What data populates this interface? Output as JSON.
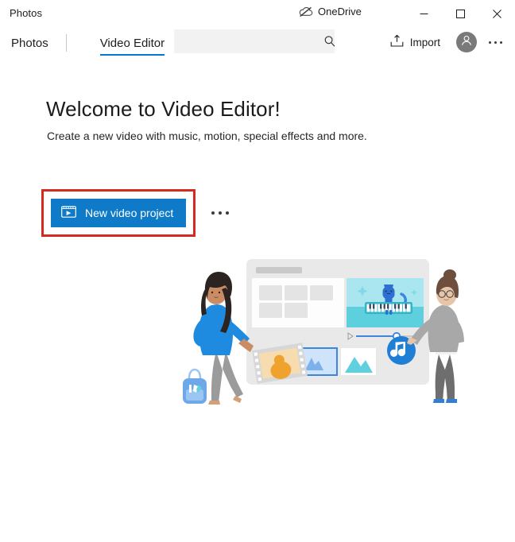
{
  "window": {
    "app_title": "Photos",
    "onedrive_label": "OneDrive",
    "onedrive_icon": "cloud-slash-icon",
    "minimize_label": "Minimize",
    "maximize_label": "Maximize",
    "close_label": "Close"
  },
  "commandbar": {
    "tabs": [
      {
        "label": "Photos",
        "active": false,
        "name": "tab-photos"
      },
      {
        "label": "Video Editor",
        "active": true,
        "name": "tab-video-editor"
      }
    ],
    "search": {
      "value": "",
      "placeholder": "",
      "icon": "search-icon"
    },
    "import_label": "Import",
    "import_icon": "import-icon",
    "avatar_icon": "person-icon",
    "more_icon": "more-horizontal-icon"
  },
  "main": {
    "title": "Welcome to Video Editor!",
    "subtitle": "Create a new video with music, motion, special effects and more.",
    "primary_button": {
      "label": "New video project",
      "icon": "video-project-icon"
    },
    "secondary_more_icon": "more-horizontal-icon",
    "highlight_color": "#d32b24"
  },
  "illustration": {
    "name": "video-editor-hero-illustration",
    "alt": "Two people assembling a video project on a large editor screen with a cat playing a piano in the preview, media thumbnails, a music note badge and a backpack",
    "colors": {
      "accent_blue": "#0f7ac7",
      "panel_gray": "#e8e8e8",
      "preview_cyan": "#5ecfdd",
      "sky_cyan": "#a9e6ef",
      "cat_blue": "#2f6fd0",
      "sweater_blue": "#1e8ae0",
      "pants_gray": "#9b9b9b",
      "skin_left": "#c98c64",
      "skin_right": "#e8c4a8",
      "hair_dark": "#2b2420",
      "hair_brown": "#6e4f3e",
      "backpack_blue": "#6fa8e8",
      "thumb_orange": "#f0a22e",
      "mountain_cyan": "#5fd0dd"
    }
  }
}
